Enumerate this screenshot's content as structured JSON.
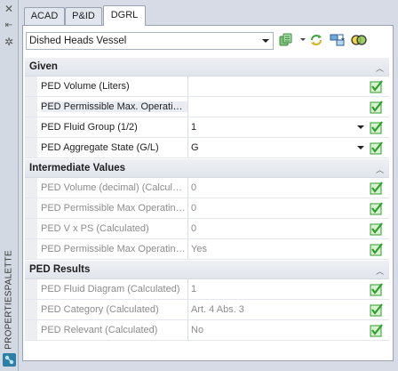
{
  "palette": {
    "title": "PROPERTIESPALETTE",
    "close_icon": "close-icon",
    "pin_icon": "pin-icon",
    "settings_icon": "gear-icon"
  },
  "tabs": [
    {
      "label": "ACAD",
      "active": false
    },
    {
      "label": "P&ID",
      "active": false
    },
    {
      "label": "DGRL",
      "active": true
    }
  ],
  "toolbar": {
    "selected_object": "Dished Heads Vessel",
    "icons": [
      "quick-select-icon",
      "refresh-icon",
      "export-icon",
      "toggle-view-icon"
    ]
  },
  "sections": [
    {
      "title": "Given",
      "rows": [
        {
          "label": "PED Volume (Liters)",
          "value": "",
          "dropdown": false,
          "disabled": false
        },
        {
          "label": "PED Permissible Max. Operating...",
          "value": "",
          "dropdown": false,
          "disabled": false
        },
        {
          "label": "PED Fluid Group (1/2)",
          "value": "1",
          "dropdown": true,
          "disabled": false
        },
        {
          "label": "PED Aggregate State (G/L)",
          "value": "G",
          "dropdown": true,
          "disabled": false
        }
      ]
    },
    {
      "title": "Intermediate Values",
      "rows": [
        {
          "label": "PED Volume (decimal) (Calculate...",
          "value": "0",
          "dropdown": false,
          "disabled": true
        },
        {
          "label": "PED Permissible Max Operating ...",
          "value": "0",
          "dropdown": false,
          "disabled": true
        },
        {
          "label": "PED V x PS (Calculated)",
          "value": "0",
          "dropdown": false,
          "disabled": true
        },
        {
          "label": "PED Permissible Max Operating ...",
          "value": "Yes",
          "dropdown": false,
          "disabled": true
        }
      ]
    },
    {
      "title": "PED Results",
      "rows": [
        {
          "label": "PED Fluid Diagram (Calculated)",
          "value": "1",
          "dropdown": false,
          "disabled": true
        },
        {
          "label": "PED Category (Calculated)",
          "value": "Art. 4 Abs. 3",
          "dropdown": false,
          "disabled": true
        },
        {
          "label": "PED Relevant (Calculated)",
          "value": "No",
          "dropdown": false,
          "disabled": true
        }
      ]
    }
  ],
  "colors": {
    "accent_green": "#2e9e2e",
    "check_bg": "#d9f3d0",
    "disabled_text": "#8c8c8c"
  }
}
